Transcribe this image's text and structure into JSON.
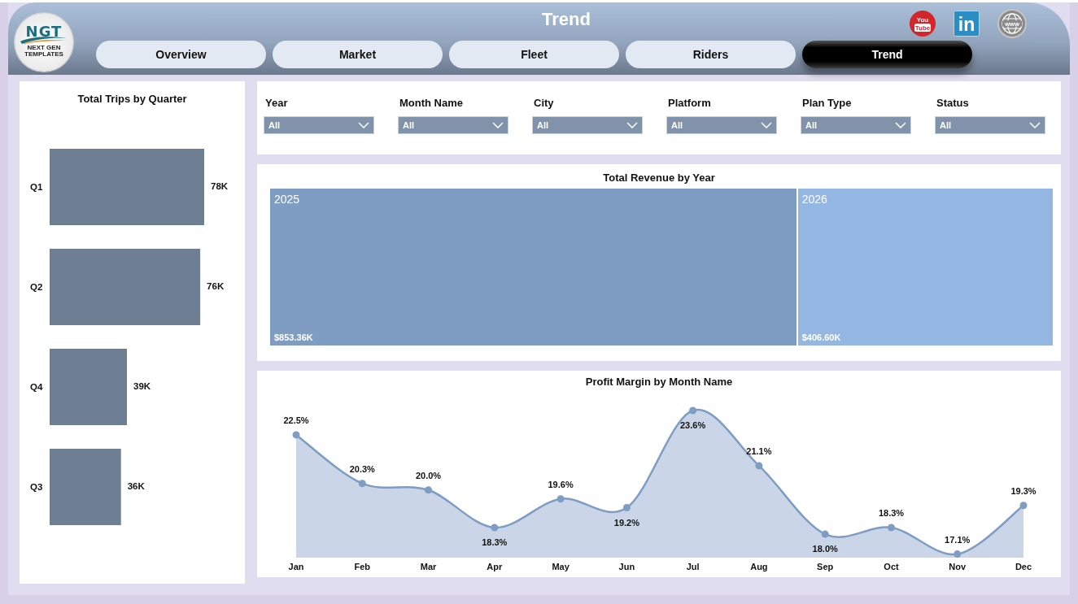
{
  "header": {
    "logo": {
      "text": "NGT",
      "tagline": "NEXT GEN TEMPLATES"
    },
    "title": "Trend",
    "social_links": [
      {
        "kind": "video",
        "text": "You",
        "subtext": "Tube"
      },
      {
        "kind": "network",
        "text": "in"
      },
      {
        "kind": "web",
        "text": "www"
      }
    ]
  },
  "tabs": [
    {
      "label": "Overview",
      "selected": false
    },
    {
      "label": "Market",
      "selected": false
    },
    {
      "label": "Fleet",
      "selected": false
    },
    {
      "label": "Riders",
      "selected": false
    },
    {
      "label": "Trend",
      "selected": true
    }
  ],
  "trips_chart": {
    "chart_data": {
      "type": "bar",
      "orientation": "horizontal",
      "title": "Total Trips by Quarter",
      "categories": [
        "Q1",
        "Q2",
        "Q4",
        "Q3"
      ],
      "values": [
        78000,
        76000,
        39000,
        36000
      ],
      "value_labels": [
        "78K",
        "76K",
        "39K",
        "36K"
      ]
    }
  },
  "filters": [
    {
      "label": "Year",
      "value": "All"
    },
    {
      "label": "Month Name",
      "value": "All"
    },
    {
      "label": "City",
      "value": "All"
    },
    {
      "label": "Platform",
      "value": "All"
    },
    {
      "label": "Plan Type",
      "value": "All"
    },
    {
      "label": "Status",
      "value": "All"
    }
  ],
  "revenue_treemap": {
    "title": "Total Revenue by Year",
    "tiles": [
      {
        "label": "2025",
        "value": "$853.36K",
        "color": "#7f9cc2"
      },
      {
        "label": "2026",
        "value": "$406.60K",
        "color": "#93b6e2"
      }
    ]
  },
  "margin_chart": {
    "chart_data": {
      "type": "area",
      "title": "Profit Margin by Month Name",
      "categories": [
        "Jan",
        "Feb",
        "Mar",
        "Apr",
        "May",
        "Jun",
        "Jul",
        "Aug",
        "Sep",
        "Oct",
        "Nov",
        "Dec"
      ],
      "values": [
        22.5,
        20.3,
        20.0,
        18.3,
        19.6,
        19.2,
        23.6,
        21.1,
        18.0,
        18.3,
        17.1,
        19.3
      ],
      "value_labels": [
        "22.5%",
        "20.3%",
        "20.0%",
        "18.3%",
        "19.6%",
        "19.2%",
        "23.6%",
        "21.1%",
        "18.0%",
        "18.3%",
        "17.1%",
        "19.3%"
      ]
    }
  }
}
